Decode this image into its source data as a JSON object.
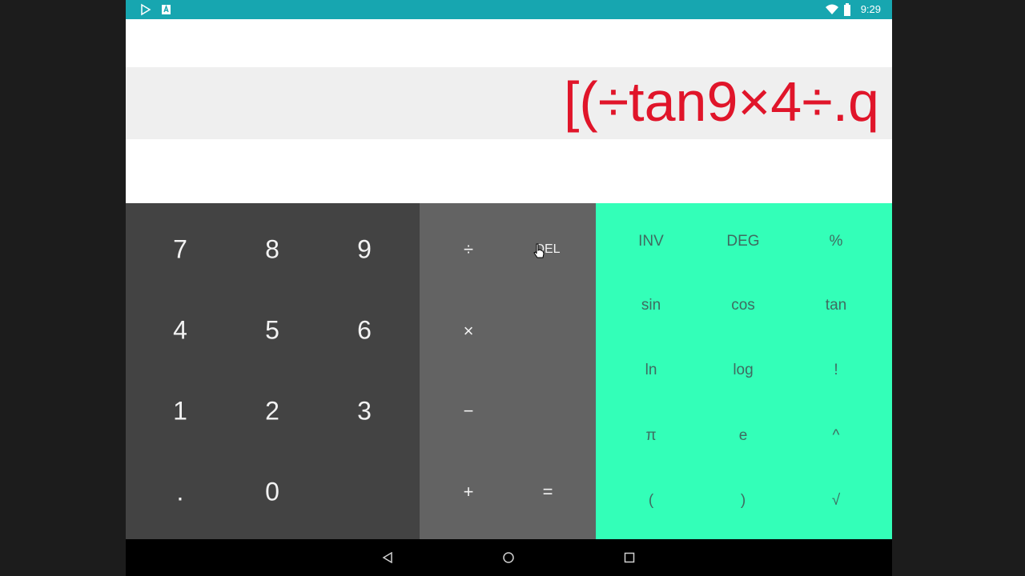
{
  "status_bar": {
    "time": "9:29",
    "icons_left": [
      "play-store-icon",
      "notification-a-icon"
    ],
    "icons_right": [
      "wifi-icon",
      "battery-icon"
    ],
    "color": "#17a6b0"
  },
  "display": {
    "formula": "[(÷tan9×4÷.q",
    "result": "",
    "formula_color": "#e0152a"
  },
  "numpad": {
    "keys": [
      "7",
      "8",
      "9",
      "4",
      "5",
      "6",
      "1",
      "2",
      "3",
      ".",
      "0"
    ],
    "color": "#434343"
  },
  "operators": {
    "divide": "÷",
    "delete": "DEL",
    "multiply": "×",
    "minus": "−",
    "plus": "+",
    "equals": "=",
    "color": "#636363"
  },
  "advanced": {
    "keys": [
      "INV",
      "DEG",
      "%",
      "sin",
      "cos",
      "tan",
      "ln",
      "log",
      "!",
      "π",
      "e",
      "^",
      "(",
      ")",
      "√"
    ],
    "color": "#33ffb8"
  },
  "nav_bar": {
    "buttons": [
      "back-icon",
      "home-icon",
      "recents-icon"
    ]
  }
}
